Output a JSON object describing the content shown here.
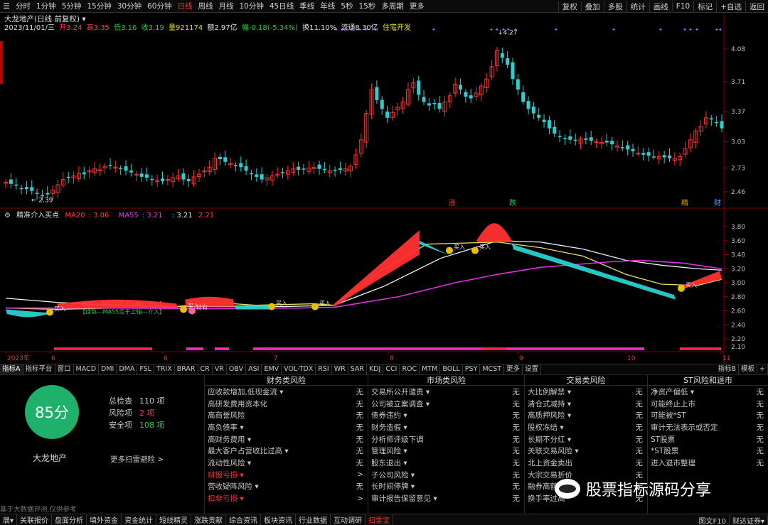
{
  "toolbar": {
    "periods": [
      "分时",
      "1分钟",
      "5分钟",
      "15分钟",
      "30分钟",
      "60分钟",
      "日线",
      "周线",
      "月线",
      "10分钟",
      "45日线",
      "季线",
      "年线",
      "5秒",
      "15秒",
      "多周期",
      "更多"
    ],
    "active_period_index": 6,
    "tools": [
      "复权",
      "叠加",
      "多股",
      "统计",
      "画线",
      "F10",
      "标记",
      "+自选",
      "返回"
    ]
  },
  "stock": {
    "title": "大龙地产(日线 前复权)",
    "date": "2023/11/01/三",
    "open_label": "开3.24",
    "high_label": "高3.35",
    "low_label": "低3.16",
    "close_label": "收3.19",
    "volume_label": "量921174",
    "amount_label": "额2.97亿",
    "change_label": "幅-0.18(-5.34%)",
    "turnover_label": "换11.10%",
    "float_label": "流通8.30亿",
    "status_label": "住宅开发"
  },
  "price_axis": [
    "4.08",
    "3.71",
    "3.37",
    "3.03",
    "2.73",
    "2.46"
  ],
  "low_marker": "2.39",
  "high_marker": "4.27",
  "event_tags": [
    {
      "text": "涨",
      "color": "#ff3030"
    },
    {
      "text": "跌",
      "color": "#2ecc40"
    },
    {
      "text": "精",
      "color": "#e8a000"
    },
    {
      "text": "财",
      "color": "#4da6ff"
    }
  ],
  "indicator": {
    "name": "精准介入买点",
    "ma20_label": "MA20",
    "ma20_value": "3.06",
    "ma55_label": "MA55",
    "ma55_value": "3.21",
    "v1": ": 3.21",
    "v2": "2.21",
    "axis": [
      "3.80",
      "3.60",
      "3.40",
      "3.20",
      "3.00",
      "2.80",
      "2.60",
      "2.40",
      "2.20",
      "2.10"
    ],
    "legend_red": "【红色---MA20走于上轴---介入】",
    "legend_green": "【绿色---MA55走于上轴---介入】",
    "buy_label": "买入",
    "hold_label": "持有"
  },
  "time_axis": [
    "2023年",
    "6",
    "6",
    "7",
    "8",
    "9",
    "10",
    "11"
  ],
  "indicator_tabs": [
    "指标A",
    "指标平台",
    "窗口",
    "MACD",
    "DMI",
    "DMA",
    "FSL",
    "TRIX",
    "BRAR",
    "CR",
    "VR",
    "OBV",
    "ASI",
    "EMV",
    "VOL-TDX",
    "RSI",
    "WR",
    "SAR",
    "KDJ",
    "CCI",
    "ROC",
    "MTM",
    "BOLL",
    "PSY",
    "MCST",
    "更多",
    "设置"
  ],
  "indicator_tabs_right": [
    "指标B",
    "模板",
    "+"
  ],
  "scan": {
    "score": "85分",
    "stock_name": "大龙地产",
    "total_label": "总检查",
    "total_value": "110 项",
    "risk_label": "风险项",
    "risk_value": "2 项",
    "safe_label": "安全项",
    "safe_value": "108 项",
    "more_link": "更多扫雷避险 >",
    "disclaimer": "基于大数据评测,仅供参考",
    "columns": [
      {
        "title": "财务类风险",
        "rows": [
          {
            "label": "应收款增加,低现金流 ▾",
            "status": "无"
          },
          {
            "label": "高研发费用资本化",
            "status": "无"
          },
          {
            "label": "高商誉风险",
            "status": "无"
          },
          {
            "label": "高负债率 ▾",
            "status": "无"
          },
          {
            "label": "高财务费用 ▾",
            "status": "无"
          },
          {
            "label": "最大客户占营收比过高 ▾",
            "status": "无"
          },
          {
            "label": "流动性风险 ▾",
            "status": "无"
          },
          {
            "label": "财报亏损 ▾",
            "status": ">",
            "warn": true
          },
          {
            "label": "营收疑阵风险 ▾",
            "status": "无"
          },
          {
            "label": "扣非亏损 ▾",
            "status": ">",
            "warn": true
          }
        ]
      },
      {
        "title": "市场类风险",
        "rows": [
          {
            "label": "交易所公开谴责 ▾",
            "status": "无"
          },
          {
            "label": "公司被立案调查 ▾",
            "status": "无"
          },
          {
            "label": "债券违约 ▾",
            "status": "无"
          },
          {
            "label": "财务造假 ▾",
            "status": "无"
          },
          {
            "label": "分析师评级下调",
            "status": "无"
          },
          {
            "label": "管理风险 ▾",
            "status": "无"
          },
          {
            "label": "股东退出 ▾",
            "status": "无"
          },
          {
            "label": "子公司风险 ▾",
            "status": "无"
          },
          {
            "label": "长时间停牌 ▾",
            "status": "无"
          },
          {
            "label": "审计报告保留意见 ▾",
            "status": "无"
          }
        ]
      },
      {
        "title": "交易类风险",
        "rows": [
          {
            "label": "大比例解禁 ▾",
            "status": "无"
          },
          {
            "label": "清仓式减持 ▾",
            "status": "无"
          },
          {
            "label": "高质押风险 ▾",
            "status": "无"
          },
          {
            "label": "股权冻结 ▾",
            "status": "无"
          },
          {
            "label": "长期不分红 ▾",
            "status": "无"
          },
          {
            "label": "关联交易风险 ▾",
            "status": "无"
          },
          {
            "label": "北上资金卖出",
            "status": "无"
          },
          {
            "label": "大宗交易折价",
            "status": "无"
          },
          {
            "label": "融券高额",
            "status": "无"
          },
          {
            "label": "换手率过高",
            "status": "无"
          }
        ]
      },
      {
        "title": "ST风险和退市",
        "rows": [
          {
            "label": "净资产偏低 ▾",
            "status": "无"
          },
          {
            "label": "可能终止上市",
            "status": "无"
          },
          {
            "label": "可能被*ST",
            "status": "无"
          },
          {
            "label": "审计无法表示或否定",
            "status": "无"
          },
          {
            "label": "ST股票",
            "status": "无"
          },
          {
            "label": "*ST股票",
            "status": "无"
          },
          {
            "label": "进入退市整理",
            "status": "无"
          }
        ]
      }
    ]
  },
  "watermark": "股票指标源码分享",
  "status_bar": {
    "items": [
      "展▾",
      "关联报价",
      "盘面分析",
      "填外资金",
      "资金统计",
      "短线精灵",
      "涨跌贡献",
      "综合资讯",
      "板块资讯",
      "行业数据",
      "互动调研",
      "扫雷宝"
    ],
    "active_index": 11,
    "right": [
      "图文F10",
      "财达证券▾"
    ]
  },
  "colors": {
    "up": "#ff3030",
    "down": "#2ad0d0",
    "ma_white": "#f0f0f0",
    "ma_yellow": "#f0e060",
    "ma_magenta": "#e030e0",
    "score_green": "#1fb06b"
  }
}
